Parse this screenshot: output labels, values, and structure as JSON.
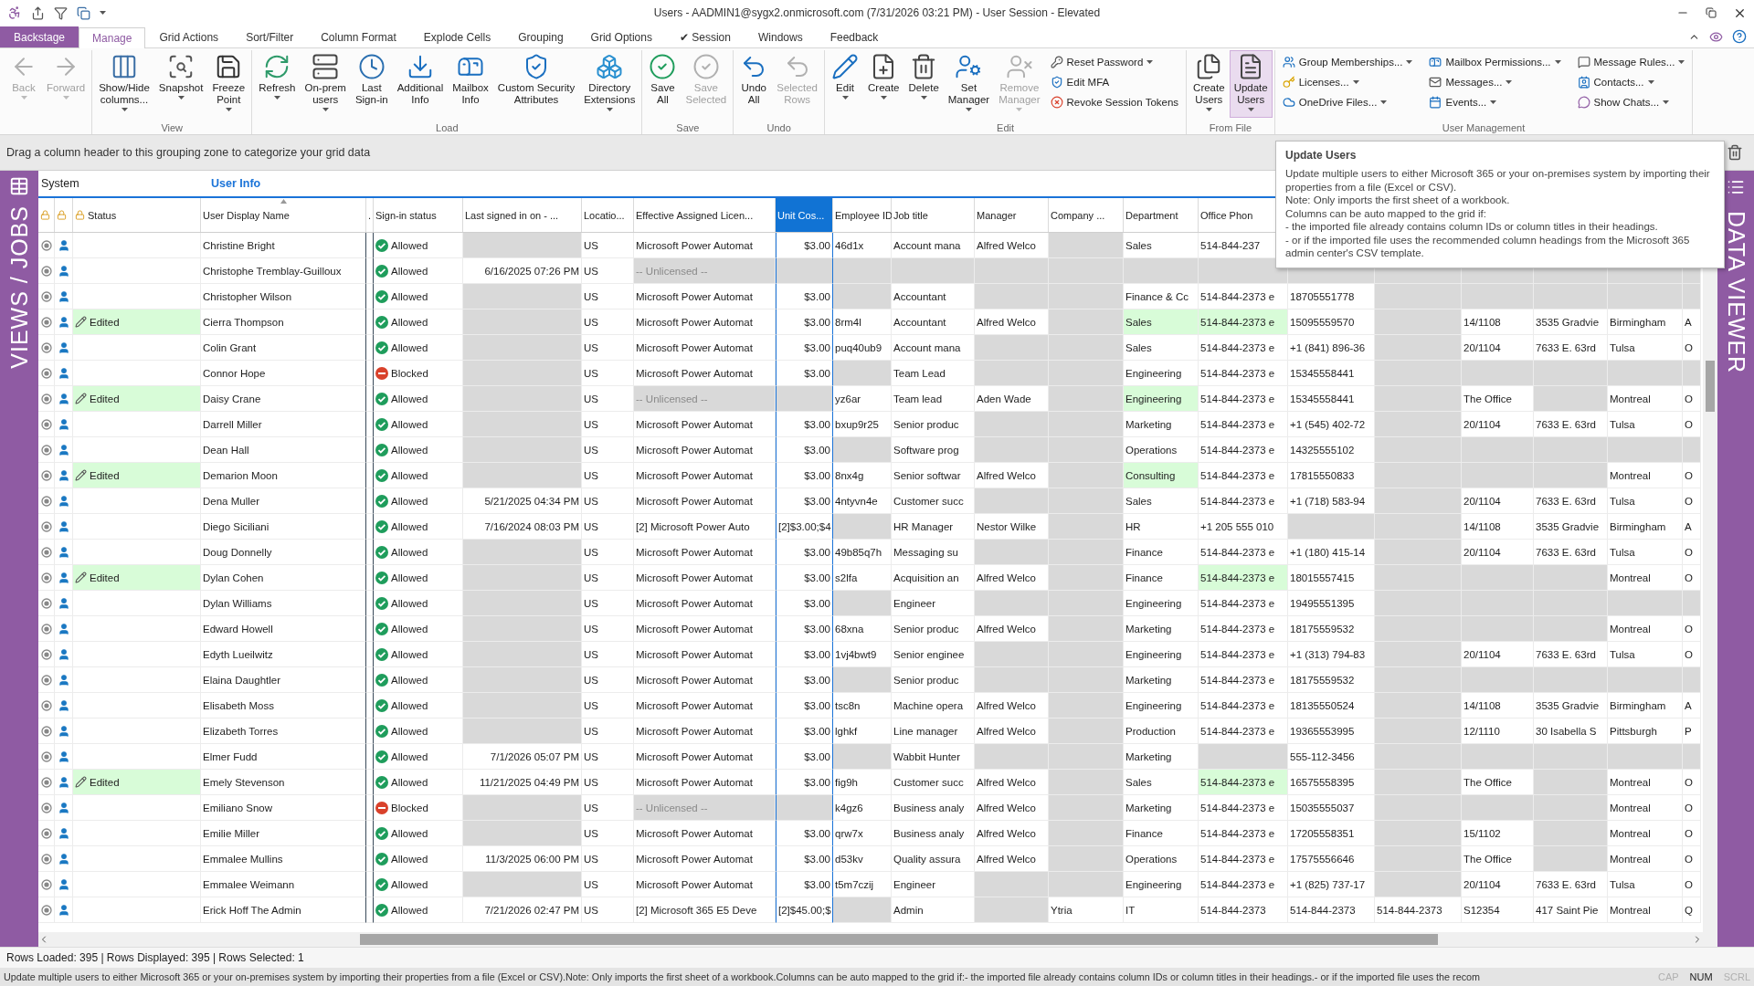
{
  "window": {
    "title": "Users - AADMIN1@sygx2.onmicrosoft.com (7/31/2026 03:21 PM) - User Session - Elevated"
  },
  "tabs": [
    {
      "label": "Backstage",
      "kind": "backstage",
      "selected": false
    },
    {
      "label": "Manage",
      "kind": "tab",
      "selected": true
    },
    {
      "label": "Grid Actions",
      "kind": "tab",
      "selected": false
    },
    {
      "label": "Sort/Filter",
      "kind": "tab",
      "selected": false
    },
    {
      "label": "Column Format",
      "kind": "tab",
      "selected": false
    },
    {
      "label": "Explode Cells",
      "kind": "tab",
      "selected": false
    },
    {
      "label": "Grouping",
      "kind": "tab",
      "selected": false
    },
    {
      "label": "Grid Options",
      "kind": "tab",
      "selected": false
    },
    {
      "label": "✔ Session",
      "kind": "tab",
      "selected": false
    },
    {
      "label": "Windows",
      "kind": "tab",
      "selected": false
    },
    {
      "label": "Feedback",
      "kind": "tab",
      "selected": false
    }
  ],
  "ribbon": [
    {
      "buttons": [
        {
          "label": "Back",
          "disabled": true,
          "dropdown": true,
          "highlighted": false
        },
        {
          "label": "Forward",
          "disabled": true,
          "dropdown": true,
          "highlighted": false
        }
      ]
    },
    {
      "label": "View",
      "buttons": [
        {
          "label": "Show/Hide\ncolumns...",
          "disabled": false,
          "dropdown": true,
          "highlighted": false
        },
        {
          "label": "Snapshot",
          "disabled": false,
          "dropdown": true,
          "highlighted": false
        },
        {
          "label": "Freeze\nPoint",
          "disabled": false,
          "dropdown": true,
          "highlighted": false
        }
      ]
    },
    {
      "label": "Load",
      "buttons": [
        {
          "label": "Refresh",
          "disabled": false,
          "dropdown": true,
          "highlighted": false
        },
        {
          "label": "On-prem\nusers",
          "disabled": false,
          "dropdown": true,
          "highlighted": false
        },
        {
          "label": "Last\nSign-in",
          "disabled": false,
          "dropdown": false,
          "highlighted": false
        },
        {
          "label": "Additional\nInfo",
          "disabled": false,
          "dropdown": false,
          "highlighted": false
        },
        {
          "label": "Mailbox\nInfo",
          "disabled": false,
          "dropdown": false,
          "highlighted": false
        },
        {
          "label": "Custom Security\nAttributes",
          "disabled": false,
          "dropdown": false,
          "highlighted": false
        },
        {
          "label": "Directory\nExtensions",
          "disabled": false,
          "dropdown": true,
          "highlighted": false
        }
      ]
    },
    {
      "label": "Save",
      "buttons": [
        {
          "label": "Save\nAll",
          "disabled": false,
          "dropdown": false,
          "highlighted": false
        },
        {
          "label": "Save\nSelected",
          "disabled": true,
          "dropdown": false,
          "highlighted": false
        }
      ]
    },
    {
      "label": "Undo",
      "buttons": [
        {
          "label": "Undo\nAll",
          "disabled": false,
          "dropdown": false,
          "highlighted": false
        },
        {
          "label": "Selected\nRows",
          "disabled": true,
          "dropdown": false,
          "highlighted": false
        }
      ]
    },
    {
      "label": "Edit",
      "buttons": [
        {
          "label": "Edit",
          "disabled": false,
          "dropdown": true,
          "highlighted": false
        },
        {
          "label": "Create",
          "disabled": false,
          "dropdown": true,
          "highlighted": false
        },
        {
          "label": "Delete",
          "disabled": false,
          "dropdown": true,
          "highlighted": false
        },
        {
          "label": "Set\nManager",
          "disabled": false,
          "dropdown": true,
          "highlighted": false
        },
        {
          "label": "Remove\nManager",
          "disabled": true,
          "dropdown": true,
          "highlighted": false
        }
      ],
      "small": [
        {
          "label": "Reset Password",
          "dropdown": true
        },
        {
          "label": "Edit MFA",
          "dropdown": false
        },
        {
          "label": "Revoke Session Tokens",
          "dropdown": false
        }
      ]
    },
    {
      "label": "From File",
      "buttons": [
        {
          "label": "Create\nUsers",
          "disabled": false,
          "dropdown": true,
          "highlighted": false
        },
        {
          "label": "Update\nUsers",
          "disabled": false,
          "dropdown": true,
          "highlighted": true
        }
      ]
    },
    {
      "label": "User Management",
      "small": [
        {
          "label": "Group Memberships...",
          "dropdown": true
        },
        {
          "label": "Licenses...",
          "dropdown": true
        },
        {
          "label": "OneDrive Files...",
          "dropdown": true
        },
        {
          "label": "Mailbox Permissions...",
          "dropdown": true
        },
        {
          "label": "Messages...",
          "dropdown": true
        },
        {
          "label": "Events...",
          "dropdown": true
        },
        {
          "label": "Message Rules...",
          "dropdown": true
        },
        {
          "label": "Contacts...",
          "dropdown": true
        },
        {
          "label": "Show Chats...",
          "dropdown": true
        }
      ]
    }
  ],
  "grouping_zone": {
    "hint": "Drag a column header to this grouping zone to categorize your grid data"
  },
  "left_panel": {
    "title": "VIEWS / JOBS"
  },
  "right_panel": {
    "title": "DATA VIEWER"
  },
  "bands": [
    "System",
    "User Info"
  ],
  "columns": [
    {
      "title": "Status",
      "selected": false,
      "sorted": false
    },
    {
      "title": "User Display Name",
      "selected": false,
      "sorted": true
    },
    {
      "title": ".",
      "selected": false,
      "sorted": false
    },
    {
      "title": "Sign-in status",
      "selected": false,
      "sorted": false
    },
    {
      "title": "Last signed in on - ...",
      "selected": false,
      "sorted": false
    },
    {
      "title": "Locatio...",
      "selected": false,
      "sorted": false
    },
    {
      "title": "Effective Assigned Licen...",
      "selected": false,
      "sorted": false
    },
    {
      "title": "Unit Cos...",
      "selected": true,
      "sorted": false
    },
    {
      "title": "Employee ID",
      "selected": false,
      "sorted": false
    },
    {
      "title": "Job title",
      "selected": false,
      "sorted": false
    },
    {
      "title": "Manager",
      "selected": false,
      "sorted": false
    },
    {
      "title": "Company ...",
      "selected": false,
      "sorted": false
    },
    {
      "title": "Department",
      "selected": false,
      "sorted": false
    },
    {
      "title": "Office Phon",
      "selected": false,
      "sorted": false
    }
  ],
  "rows": [
    {
      "name": "Christine Bright",
      "edited": false,
      "signin": {
        "kind": "allowed",
        "text": "Allowed"
      },
      "cells": [
        null,
        "US",
        "Microsoft Power Automat",
        "$3.00",
        "46d1x",
        "Account mana",
        "Alfred Welco",
        null,
        "Sales",
        "514-844-237"
      ]
    },
    {
      "name": "Christophe Tremblay-Guilloux",
      "edited": false,
      "signin": {
        "kind": "allowed",
        "text": "Allowed"
      },
      "cells": [
        "6/16/2025 07:26 PM",
        "US",
        {
          "text": "-- Unlicensed --",
          "kind": "muted"
        },
        null,
        null,
        null,
        null,
        null,
        null,
        null,
        null,
        null,
        null,
        null,
        null,
        null
      ]
    },
    {
      "name": "Christopher Wilson",
      "edited": false,
      "signin": {
        "kind": "allowed",
        "text": "Allowed"
      },
      "cells": [
        null,
        "US",
        "Microsoft Power Automat",
        "$3.00",
        null,
        "Accountant",
        null,
        null,
        "Finance & Cc",
        "514-844-2373 e",
        "18705551778",
        null,
        null,
        null,
        null,
        null
      ]
    },
    {
      "name": "Cierra Thompson",
      "edited": true,
      "status": "Edited",
      "signin": {
        "kind": "allowed",
        "text": "Allowed"
      },
      "cells": [
        null,
        "US",
        "Microsoft Power Automat",
        "$3.00",
        "8rm4l",
        "Accountant",
        "Alfred Welco",
        null,
        {
          "text": "Sales",
          "kind": "changed"
        },
        {
          "text": "514-844-2373 e",
          "kind": "changed"
        },
        "15095559570",
        null,
        "14/1108",
        "3535 Gradvie",
        "Birmingham",
        "A"
      ]
    },
    {
      "name": "Colin Grant",
      "edited": false,
      "signin": {
        "kind": "allowed",
        "text": "Allowed"
      },
      "cells": [
        null,
        "US",
        "Microsoft Power Automat",
        "$3.00",
        "puq40ub9",
        "Account mana",
        null,
        null,
        "Sales",
        "514-844-2373 e",
        "+1 (841) 896-36",
        null,
        "20/1104",
        "7633 E. 63rd",
        "Tulsa",
        "O"
      ]
    },
    {
      "name": "Connor Hope",
      "edited": false,
      "signin": {
        "kind": "blocked",
        "text": "Blocked"
      },
      "cells": [
        null,
        "US",
        "Microsoft Power Automat",
        "$3.00",
        null,
        "Team Lead",
        null,
        null,
        "Engineering",
        "514-844-2373 e",
        "15345558441",
        null,
        null,
        null,
        null,
        null
      ]
    },
    {
      "name": "Daisy Crane",
      "edited": true,
      "status": "Edited",
      "signin": {
        "kind": "allowed",
        "text": "Allowed"
      },
      "cells": [
        null,
        "US",
        {
          "text": "-- Unlicensed --",
          "kind": "muted"
        },
        null,
        "yz6ar",
        "Team lead",
        "Aden Wade",
        null,
        {
          "text": "Engineering",
          "kind": "changed"
        },
        "514-844-2373 e",
        "15345558441",
        null,
        "The Office",
        null,
        "Montreal",
        "O"
      ]
    },
    {
      "name": "Darrell Miller",
      "edited": false,
      "signin": {
        "kind": "allowed",
        "text": "Allowed"
      },
      "cells": [
        null,
        "US",
        "Microsoft Power Automat",
        "$3.00",
        "bxup9r25",
        "Senior produc",
        null,
        null,
        "Marketing",
        "514-844-2373 e",
        "+1 (545) 402-72",
        null,
        "20/1104",
        "7633 E. 63rd",
        "Tulsa",
        "O"
      ]
    },
    {
      "name": "Dean Hall",
      "edited": false,
      "signin": {
        "kind": "allowed",
        "text": "Allowed"
      },
      "cells": [
        null,
        "US",
        "Microsoft Power Automat",
        "$3.00",
        null,
        "Software prog",
        null,
        null,
        "Operations",
        "514-844-2373 e",
        "14325555102",
        null,
        null,
        null,
        null,
        null
      ]
    },
    {
      "name": "Demarion Moon",
      "edited": true,
      "status": "Edited",
      "signin": {
        "kind": "allowed",
        "text": "Allowed"
      },
      "cells": [
        null,
        "US",
        "Microsoft Power Automat",
        "$3.00",
        "8nx4g",
        "Senior softwar",
        "Alfred Welco",
        null,
        {
          "text": "Consulting",
          "kind": "changed"
        },
        "514-844-2373 e",
        "17815550833",
        null,
        null,
        null,
        "Montreal",
        "O"
      ]
    },
    {
      "name": "Dena Muller",
      "edited": false,
      "signin": {
        "kind": "allowed",
        "text": "Allowed"
      },
      "cells": [
        "5/21/2025 04:34 PM",
        "US",
        "Microsoft Power Automat",
        "$3.00",
        "4ntyvn4e",
        "Customer succ",
        null,
        null,
        "Sales",
        "514-844-2373 e",
        "+1 (718) 583-94",
        null,
        "20/1104",
        "7633 E. 63rd",
        "Tulsa",
        "O"
      ]
    },
    {
      "name": "Diego Siciliani",
      "edited": false,
      "signin": {
        "kind": "allowed",
        "text": "Allowed"
      },
      "cells": [
        "7/16/2024 08:03 PM",
        "US",
        "[2] Microsoft Power Auto",
        "[2]$3.00;$4",
        null,
        "HR Manager",
        "Nestor Wilke",
        null,
        "HR",
        "+1 205 555 010",
        null,
        null,
        "14/1108",
        "3535 Gradvie",
        "Birmingham",
        "A"
      ]
    },
    {
      "name": "Doug Donnelly",
      "edited": false,
      "signin": {
        "kind": "allowed",
        "text": "Allowed"
      },
      "cells": [
        null,
        "US",
        "Microsoft Power Automat",
        "$3.00",
        "49b85q7h",
        "Messaging su",
        null,
        null,
        "Finance",
        "514-844-2373 e",
        "+1 (180) 415-14",
        null,
        "20/1104",
        "7633 E. 63rd",
        "Tulsa",
        "O"
      ]
    },
    {
      "name": "Dylan Cohen",
      "edited": true,
      "status": "Edited",
      "signin": {
        "kind": "allowed",
        "text": "Allowed"
      },
      "cells": [
        null,
        "US",
        "Microsoft Power Automat",
        "$3.00",
        "s2lfa",
        "Acquisition an",
        "Alfred Welco",
        null,
        "Finance",
        {
          "text": "514-844-2373 e",
          "kind": "changed"
        },
        "18015557415",
        null,
        null,
        null,
        "Montreal",
        "O"
      ]
    },
    {
      "name": "Dylan Williams",
      "edited": false,
      "signin": {
        "kind": "allowed",
        "text": "Allowed"
      },
      "cells": [
        null,
        "US",
        "Microsoft Power Automat",
        "$3.00",
        null,
        "Engineer",
        null,
        null,
        "Engineering",
        "514-844-2373 e",
        "19495551395",
        null,
        null,
        null,
        null,
        null
      ]
    },
    {
      "name": "Edward Howell",
      "edited": false,
      "signin": {
        "kind": "allowed",
        "text": "Allowed"
      },
      "cells": [
        null,
        "US",
        "Microsoft Power Automat",
        "$3.00",
        "68xna",
        "Senior produc",
        "Alfred Welco",
        null,
        "Marketing",
        "514-844-2373 e",
        "18175559532",
        null,
        null,
        null,
        "Montreal",
        "O"
      ]
    },
    {
      "name": "Edyth Lueilwitz",
      "edited": false,
      "signin": {
        "kind": "allowed",
        "text": "Allowed"
      },
      "cells": [
        null,
        "US",
        "Microsoft Power Automat",
        "$3.00",
        "1vj4bwt9",
        "Senior enginee",
        null,
        null,
        "Engineering",
        "514-844-2373 e",
        "+1 (313) 794-83",
        null,
        "20/1104",
        "7633 E. 63rd",
        "Tulsa",
        "O"
      ]
    },
    {
      "name": "Elaina Daughtler",
      "edited": false,
      "signin": {
        "kind": "allowed",
        "text": "Allowed"
      },
      "cells": [
        null,
        "US",
        "Microsoft Power Automat",
        "$3.00",
        null,
        "Senior produc",
        null,
        null,
        "Marketing",
        "514-844-2373 e",
        "18175559532",
        null,
        null,
        null,
        null,
        null
      ]
    },
    {
      "name": "Elisabeth Moss",
      "edited": false,
      "signin": {
        "kind": "allowed",
        "text": "Allowed"
      },
      "cells": [
        null,
        "US",
        "Microsoft Power Automat",
        "$3.00",
        "tsc8n",
        "Machine opera",
        "Alfred Welco",
        null,
        "Engineering",
        "514-844-2373 e",
        "18135550524",
        null,
        "14/1108",
        "3535 Gradvie",
        "Birmingham",
        "A"
      ]
    },
    {
      "name": "Elizabeth Torres",
      "edited": false,
      "signin": {
        "kind": "allowed",
        "text": "Allowed"
      },
      "cells": [
        null,
        "US",
        "Microsoft Power Automat",
        "$3.00",
        "lghkf",
        "Line manager",
        "Alfred Welco",
        null,
        "Production",
        "514-844-2373 e",
        "19365553995",
        null,
        "12/1110",
        "30 Isabella S",
        "Pittsburgh",
        "P"
      ]
    },
    {
      "name": "Elmer Fudd",
      "edited": false,
      "signin": {
        "kind": "allowed",
        "text": "Allowed"
      },
      "cells": [
        "7/1/2026 05:07 PM",
        "US",
        "Microsoft Power Automat",
        "$3.00",
        null,
        "Wabbit Hunter",
        null,
        null,
        "Marketing",
        null,
        "555-112-3456",
        null,
        null,
        null,
        null,
        null
      ]
    },
    {
      "name": "Emely Stevenson",
      "edited": true,
      "status": "Edited",
      "signin": {
        "kind": "allowed",
        "text": "Allowed"
      },
      "cells": [
        "11/21/2025 04:49 PM",
        "US",
        "Microsoft Power Automat",
        "$3.00",
        "fig9h",
        "Customer succ",
        "Alfred Welco",
        null,
        "Sales",
        {
          "text": "514-844-2373 e",
          "kind": "changed"
        },
        "16575558395",
        null,
        "The Office",
        null,
        "Montreal",
        "O"
      ]
    },
    {
      "name": "Emiliano Snow",
      "edited": false,
      "signin": {
        "kind": "blocked",
        "text": "Blocked"
      },
      "cells": [
        null,
        "US",
        {
          "text": "-- Unlicensed --",
          "kind": "muted"
        },
        null,
        "k4gz6",
        "Business analy",
        "Alfred Welco",
        null,
        "Marketing",
        "514-844-2373 e",
        "15035555037",
        null,
        null,
        null,
        "Montreal",
        "O"
      ]
    },
    {
      "name": "Emilie Miller",
      "edited": false,
      "signin": {
        "kind": "allowed",
        "text": "Allowed"
      },
      "cells": [
        null,
        "US",
        "Microsoft Power Automat",
        "$3.00",
        "qrw7x",
        "Business analy",
        "Alfred Welco",
        null,
        "Finance",
        "514-844-2373 e",
        "17205558351",
        null,
        "15/1102",
        null,
        "Montreal",
        "O"
      ]
    },
    {
      "name": "Emmalee Mullins",
      "edited": false,
      "signin": {
        "kind": "allowed",
        "text": "Allowed"
      },
      "cells": [
        "11/3/2025 06:00 PM",
        "US",
        "Microsoft Power Automat",
        "$3.00",
        "d53kv",
        "Quality assura",
        "Alfred Welco",
        null,
        "Operations",
        "514-844-2373 e",
        "17575556646",
        null,
        "The Office",
        null,
        "Montreal",
        "O"
      ]
    },
    {
      "name": "Emmalee Weimann",
      "edited": false,
      "signin": {
        "kind": "allowed",
        "text": "Allowed"
      },
      "cells": [
        null,
        "US",
        "Microsoft Power Automat",
        "$3.00",
        "t5m7czij",
        "Engineer",
        null,
        null,
        "Engineering",
        "514-844-2373 e",
        "+1 (825) 737-17",
        null,
        "20/1104",
        "7633 E. 63rd",
        "Tulsa",
        "O"
      ]
    },
    {
      "name": "Erick Hoff The Admin",
      "edited": false,
      "signin": {
        "kind": "allowed",
        "text": "Allowed"
      },
      "cells": [
        "7/21/2026 02:47 PM",
        "US",
        "[2] Microsoft 365 E5 Deve",
        "[2]$45.00;$",
        null,
        "Admin",
        null,
        "Ytria",
        "IT",
        "514-844-2373",
        "514-844-2373",
        "514-844-2373",
        "S12354",
        "417 Saint Pie",
        "Montreal",
        "Q"
      ]
    }
  ],
  "tooltip": {
    "title": "Update Users",
    "lines": [
      "Update multiple users to either Microsoft 365 or your on-premises system by importing their properties from a file (Excel or CSV).",
      "Note: Only imports the first sheet of a workbook.",
      "Columns can be auto mapped to the grid if:",
      "- the imported file already contains column IDs or column titles in their headings.",
      "- or if the imported file uses the recommended column headings from the Microsoft 365 admin center's CSV template."
    ]
  },
  "status_bar": {
    "text": "Rows Loaded: 395 | Rows Displayed: 395 | Rows Selected: 1"
  },
  "message_bar": {
    "text": "Update multiple users to either Microsoft 365 or your on-premises system by importing their properties from a file (Excel or CSV).Note: Only imports the first sheet of a workbook.Columns can be auto mapped to the grid if:- the imported file already contains column IDs or column titles in their headings.- or if the imported file uses the recom",
    "indicators": [
      {
        "label": "CAP",
        "on": false
      },
      {
        "label": "NUM",
        "on": true
      },
      {
        "label": "SCRL",
        "on": false
      }
    ]
  }
}
